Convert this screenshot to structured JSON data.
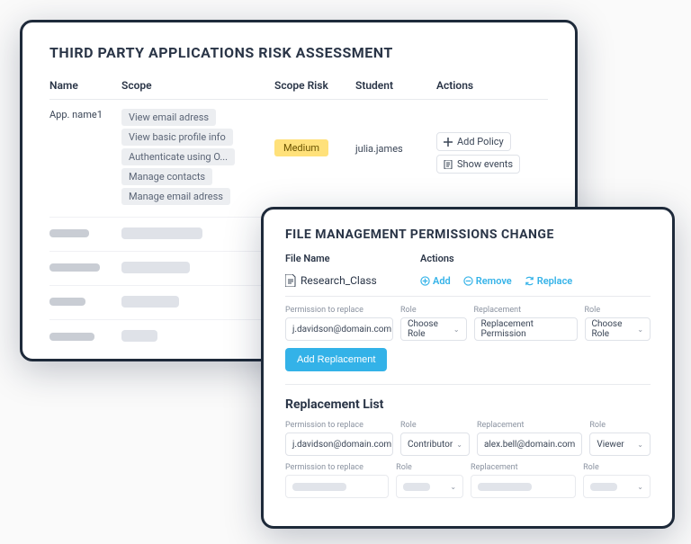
{
  "risk": {
    "title": "THIRD PARTY APPLICATIONS RISK ASSESSMENT",
    "columns": {
      "name": "Name",
      "scope": "Scope",
      "risk": "Scope Risk",
      "student": "Student",
      "actions": "Actions"
    },
    "row": {
      "app": "App. name1",
      "scopes": [
        "View email adress",
        "View basic profile info",
        "Authenticate using O...",
        "Manage contacts",
        "Manage email adress"
      ],
      "risk": "Medium",
      "student": "julia.james",
      "add_policy": "Add Policy",
      "show_events": "Show events"
    }
  },
  "perm": {
    "title": "FILE MANAGEMENT PERMISSIONS CHANGE",
    "columns": {
      "filename": "File Name",
      "actions": "Actions"
    },
    "filename": "Research_Class",
    "actions": {
      "add": "Add",
      "remove": "Remove",
      "replace": "Replace"
    },
    "labels": {
      "perm_replace": "Permission to replace",
      "role": "Role",
      "replacement": "Replacement",
      "choose_role": "Choose Role",
      "replacement_perm": "Replacement Permission",
      "add_replacement": "Add Replacement",
      "replacement_list": "Replacement List"
    },
    "form": {
      "email": "j.davidson@domain.com"
    },
    "list": {
      "row1": {
        "email1": "j.davidson@domain.com",
        "role1": "Contributor",
        "email2": "alex.bell@domain.com",
        "role2": "Viewer"
      }
    }
  }
}
